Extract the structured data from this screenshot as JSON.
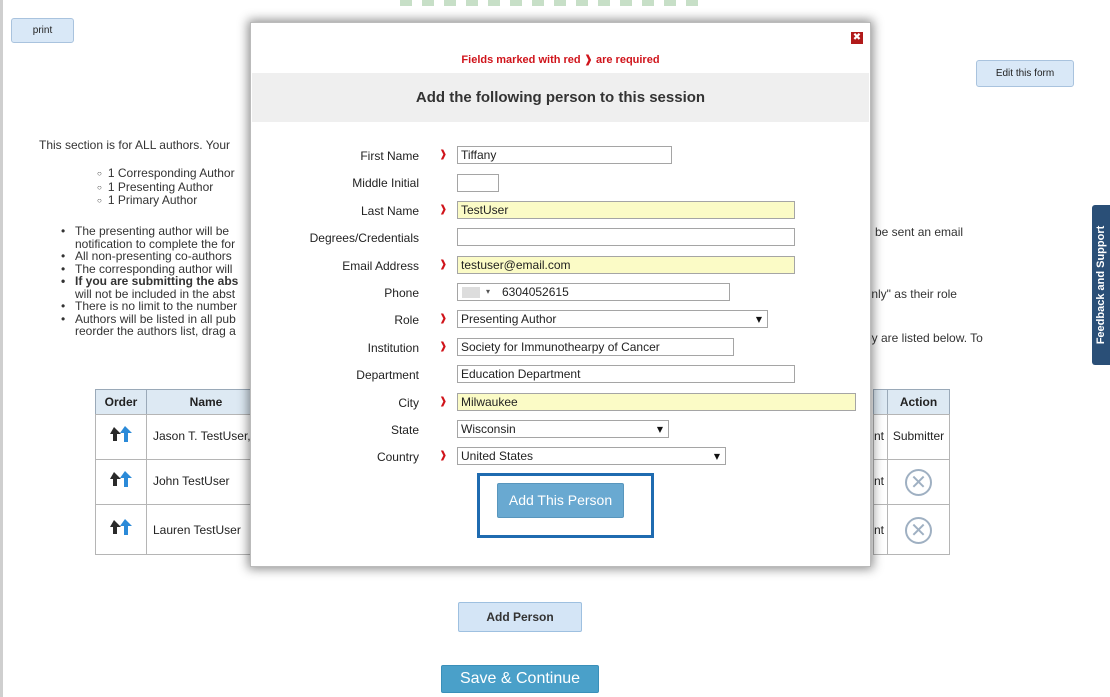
{
  "page": {
    "print_label": "print",
    "edit_form_label": "Edit this form",
    "intro": "This section is for ALL authors. Your",
    "sub_items": [
      "1 Corresponding Author",
      "1 Presenting Author",
      "1 Primary Author"
    ],
    "bullet_1a": "The presenting author will be",
    "bullet_1b": "notification to complete the for",
    "bullet_2": "All non-presenting co-authors",
    "bullet_3": "The corresponding author will",
    "bullet_4a": "If you are submitting the abs",
    "bullet_4b": "will not be included in the abst",
    "bullet_5": "There is no limit to the number",
    "bullet_6a": "Authors will be listed in all pub",
    "bullet_6b": "reorder the authors list, drag a",
    "right_1": "be sent an email",
    "right_2": "Only\" as their role",
    "right_3": "ey are listed below. To",
    "add_person_label": "Add Person",
    "save_continue_label": "Save & Continue",
    "feedback_label": "Feedback and Support"
  },
  "table": {
    "headers": {
      "order": "Order",
      "name": "Name",
      "action": "Action"
    },
    "rows": [
      {
        "name": "Jason T. TestUser, a",
        "role_tail": "nt",
        "action": "Submitter"
      },
      {
        "name": "John TestUser",
        "role_tail": "nt",
        "action": ""
      },
      {
        "name": "Lauren TestUser",
        "role_tail": "nt",
        "action": ""
      }
    ]
  },
  "modal": {
    "close_symbol": "✖",
    "required_prefix": "Fields marked with red",
    "required_mark": "❱",
    "required_suffix": "are required",
    "title": "Add the following person to this session",
    "fields": {
      "first_name": {
        "label": "First Name",
        "value": "Tiffany"
      },
      "middle_initial": {
        "label": "Middle Initial",
        "value": ""
      },
      "last_name": {
        "label": "Last Name",
        "value": "TestUser"
      },
      "degrees": {
        "label": "Degrees/Credentials",
        "value": ""
      },
      "email": {
        "label": "Email Address",
        "value": "testuser@email.com"
      },
      "phone": {
        "label": "Phone",
        "value": "6304052615",
        "caret": "▾"
      },
      "role": {
        "label": "Role",
        "value": "Presenting Author"
      },
      "institution": {
        "label": "Institution",
        "value": "Society for Immunothearpy of Cancer"
      },
      "department": {
        "label": "Department",
        "value": "Education Department"
      },
      "city": {
        "label": "City",
        "value": "Milwaukee"
      },
      "state": {
        "label": "State",
        "value": "Wisconsin"
      },
      "country": {
        "label": "Country",
        "value": "United States"
      }
    },
    "add_button_label": "Add This Person"
  },
  "colors": {
    "required_red": "#d0141b",
    "accent_blue": "#4aa0c9",
    "highlight_border": "#1f6bb0",
    "field_highlight": "#fbfbc6"
  }
}
